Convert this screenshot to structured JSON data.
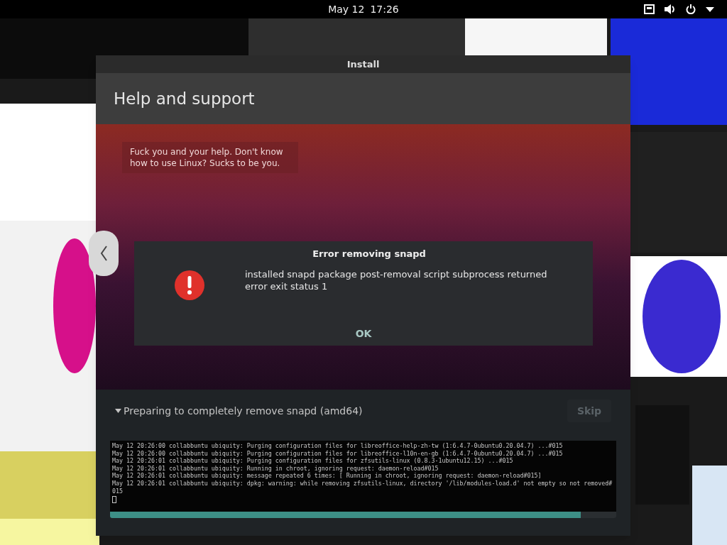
{
  "top_bar": {
    "date": "May 12",
    "time": "17:26"
  },
  "window": {
    "title": "Install",
    "header": "Help and support",
    "slide": {
      "text": "Fuck you and your help. Don't know how to use Linux? Sucks to be you."
    },
    "error_dialog": {
      "title": "Error removing snapd",
      "message": "installed snapd package post-removal script subprocess returned error exit status 1",
      "button": "OK"
    },
    "progress": {
      "expanded": true,
      "label": "Preparing to completely remove snapd (amd64)",
      "skip": {
        "label": "Skip",
        "disabled": true
      },
      "level": 0.93
    },
    "log": [
      "May 12 20:26:00 collabbuntu ubiquity: Purging configuration files for libreoffice-help-zh-tw (1:6.4.7-0ubuntu0.20.04.7) ...#015",
      "May 12 20:26:00 collabbuntu ubiquity: Purging configuration files for libreoffice-l10n-en-gb (1:6.4.7-0ubuntu0.20.04.7) ...#015",
      "May 12 20:26:01 collabbuntu ubiquity: Purging configuration files for zfsutils-linux (0.8.3-1ubuntu12.15) ...#015",
      "May 12 20:26:01 collabbuntu ubiquity: Running in chroot, ignoring request: daemon-reload#015",
      "May 12 20:26:01 collabbuntu ubiquity: message repeated 6 times: [ Running in chroot, ignoring request: daemon-reload#015]",
      "May 12 20:26:01 collabbuntu ubiquity: dpkg: warning: while removing zfsutils-linux, directory '/lib/modules-load.d' not empty so not removed#015"
    ]
  }
}
